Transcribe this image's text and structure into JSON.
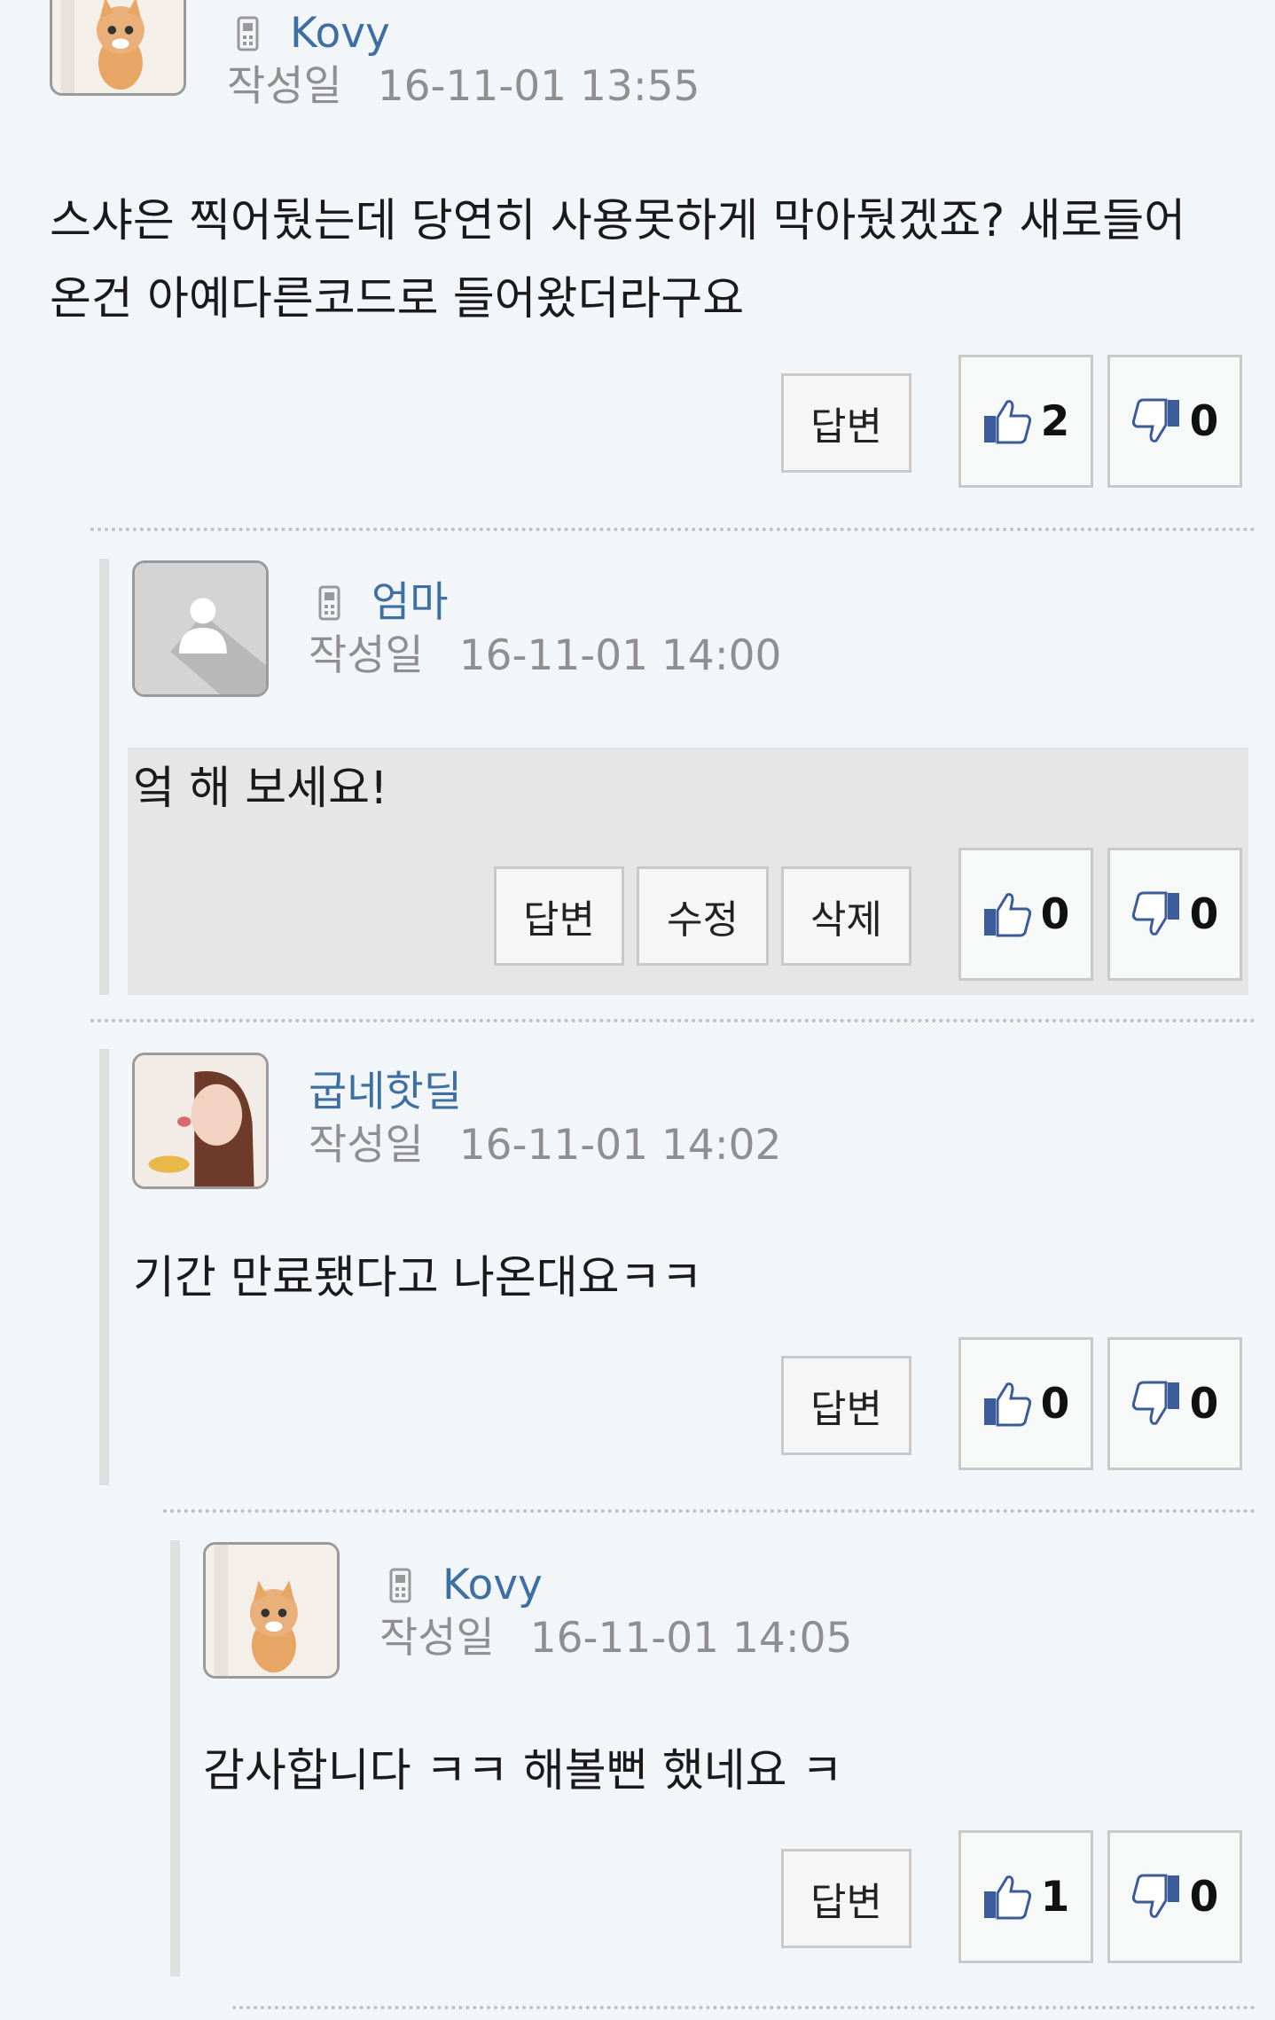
{
  "comments": [
    {
      "author": "Kovy",
      "date_label": "작성일",
      "timestamp": "16-11-01 13:55",
      "body_lines": [
        "스샤은 찍어뒀는데 당연히 사용못하게 막아뒀겠죠? 새로들어",
        "온건 아예다른코드로 들어왔더라구요"
      ],
      "buttons": [
        "답변"
      ],
      "likes": "2",
      "dislikes": "0"
    },
    {
      "author": "엄마",
      "date_label": "작성일",
      "timestamp": "16-11-01 14:00",
      "body_lines": [
        "엌 해 보세요!"
      ],
      "buttons": [
        "답변",
        "수정",
        "삭제"
      ],
      "likes": "0",
      "dislikes": "0"
    },
    {
      "author": "굽네핫딜",
      "date_label": "작성일",
      "timestamp": "16-11-01 14:02",
      "body_lines": [
        "기간 만료됐다고 나온대요ㅋㅋ"
      ],
      "buttons": [
        "답변"
      ],
      "likes": "0",
      "dislikes": "0"
    },
    {
      "author": "Kovy",
      "date_label": "작성일",
      "timestamp": "16-11-01 14:05",
      "body_lines": [
        "감사합니다 ㅋㅋ 해볼뻔 했네요 ㅋ"
      ],
      "buttons": [
        "답변"
      ],
      "likes": "1",
      "dislikes": "0"
    }
  ],
  "colors": {
    "author": "#3e6fa3",
    "meta": "#8f8f8f",
    "highlight": "#e6e6e6"
  },
  "icons": {
    "device": "phone-icon",
    "like": "thumbs-up-icon",
    "dislike": "thumbs-down-icon"
  }
}
